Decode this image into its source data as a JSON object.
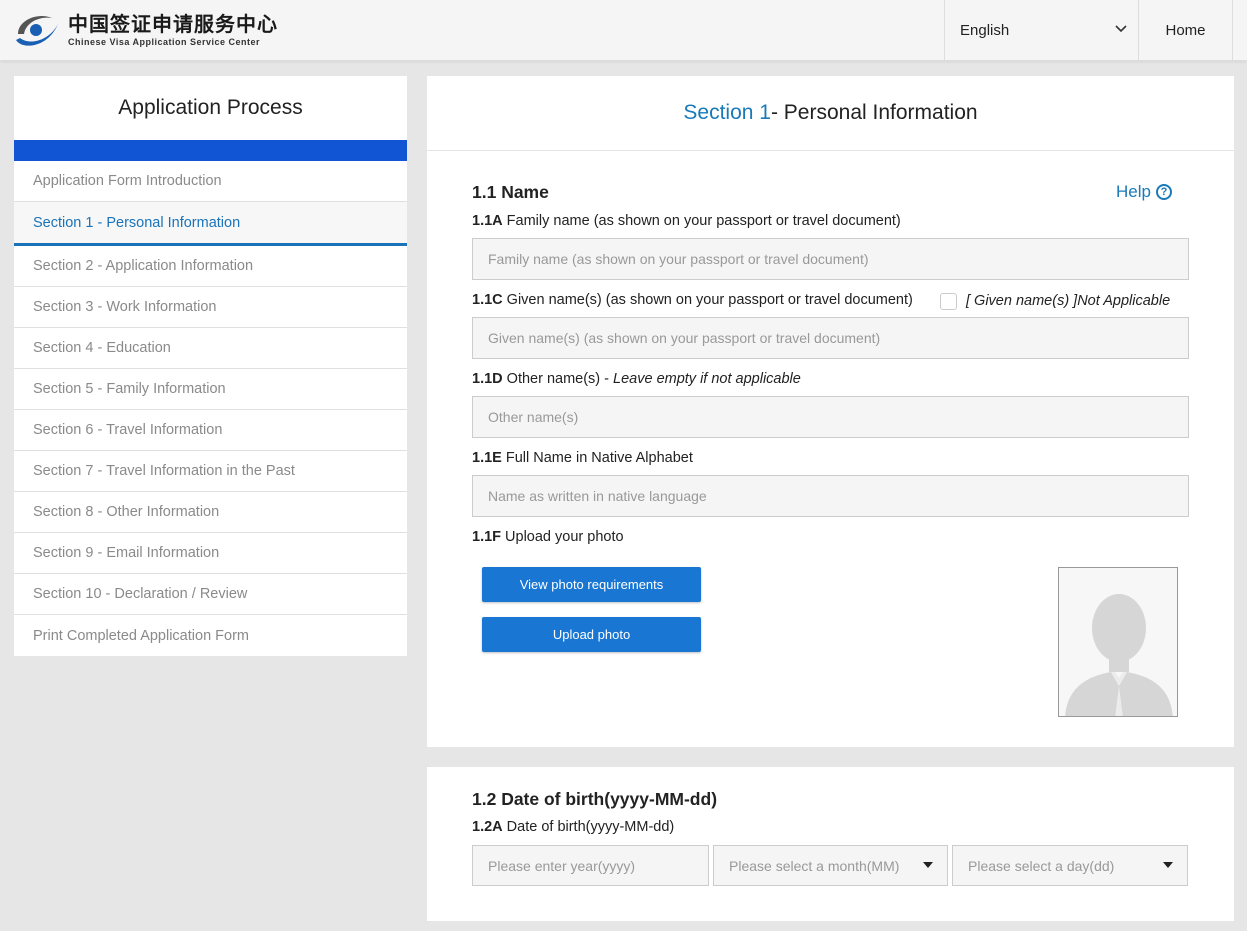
{
  "header": {
    "logo_cn": "中国签证申请服务中心",
    "logo_en": "Chinese Visa Application Service Center",
    "language": "English",
    "home": "Home"
  },
  "sidebar": {
    "title": "Application Process",
    "items": [
      {
        "label": "Application Form Introduction",
        "active": false
      },
      {
        "label": "Section 1 - Personal Information",
        "active": true
      },
      {
        "label": "Section 2 - Application Information",
        "active": false
      },
      {
        "label": "Section 3 - Work Information",
        "active": false
      },
      {
        "label": "Section 4 - Education",
        "active": false
      },
      {
        "label": "Section 5 - Family Information",
        "active": false
      },
      {
        "label": "Section 6 - Travel Information",
        "active": false
      },
      {
        "label": "Section 7 - Travel Information in the Past",
        "active": false
      },
      {
        "label": "Section 8 - Other Information",
        "active": false
      },
      {
        "label": "Section 9 - Email Information",
        "active": false
      },
      {
        "label": "Section 10 - Declaration / Review",
        "active": false
      },
      {
        "label": "Print Completed Application Form",
        "active": false
      }
    ]
  },
  "main": {
    "section_number": "Section 1",
    "section_title": " - Personal Information",
    "name_group": {
      "heading": "1.1 Name",
      "help": "Help",
      "family": {
        "code": "1.1A",
        "label": " Family name (as shown on your passport or travel document)",
        "placeholder": "Family name (as shown on your passport or travel document)"
      },
      "given": {
        "code": "1.1C",
        "label": " Given name(s) (as shown on your passport or travel document)",
        "placeholder": "Given name(s) (as shown on your passport or travel document)",
        "not_applicable": "[ Given name(s) ]Not Applicable"
      },
      "other": {
        "code": "1.1D",
        "label": " Other name(s) - ",
        "note": "Leave empty if not applicable",
        "placeholder": "Other name(s)"
      },
      "native": {
        "code": "1.1E",
        "label": " Full Name in Native Alphabet",
        "placeholder": "Name as written in native language"
      },
      "photo": {
        "code": "1.1F",
        "label": " Upload your photo",
        "requirements_button": "View photo requirements",
        "upload_button": "Upload photo"
      }
    },
    "dob_group": {
      "heading": "1.2 Date of birth(yyyy-MM-dd)",
      "code": "1.2A",
      "label": " Date of birth(yyyy-MM-dd)",
      "year_placeholder": "Please enter year(yyyy)",
      "month_placeholder": "Please select a month(MM)",
      "day_placeholder": "Please select a day(dd)"
    }
  },
  "colors": {
    "accent": "#1a7ab8",
    "progress_bar": "#1155d4",
    "button": "#1976d2"
  }
}
